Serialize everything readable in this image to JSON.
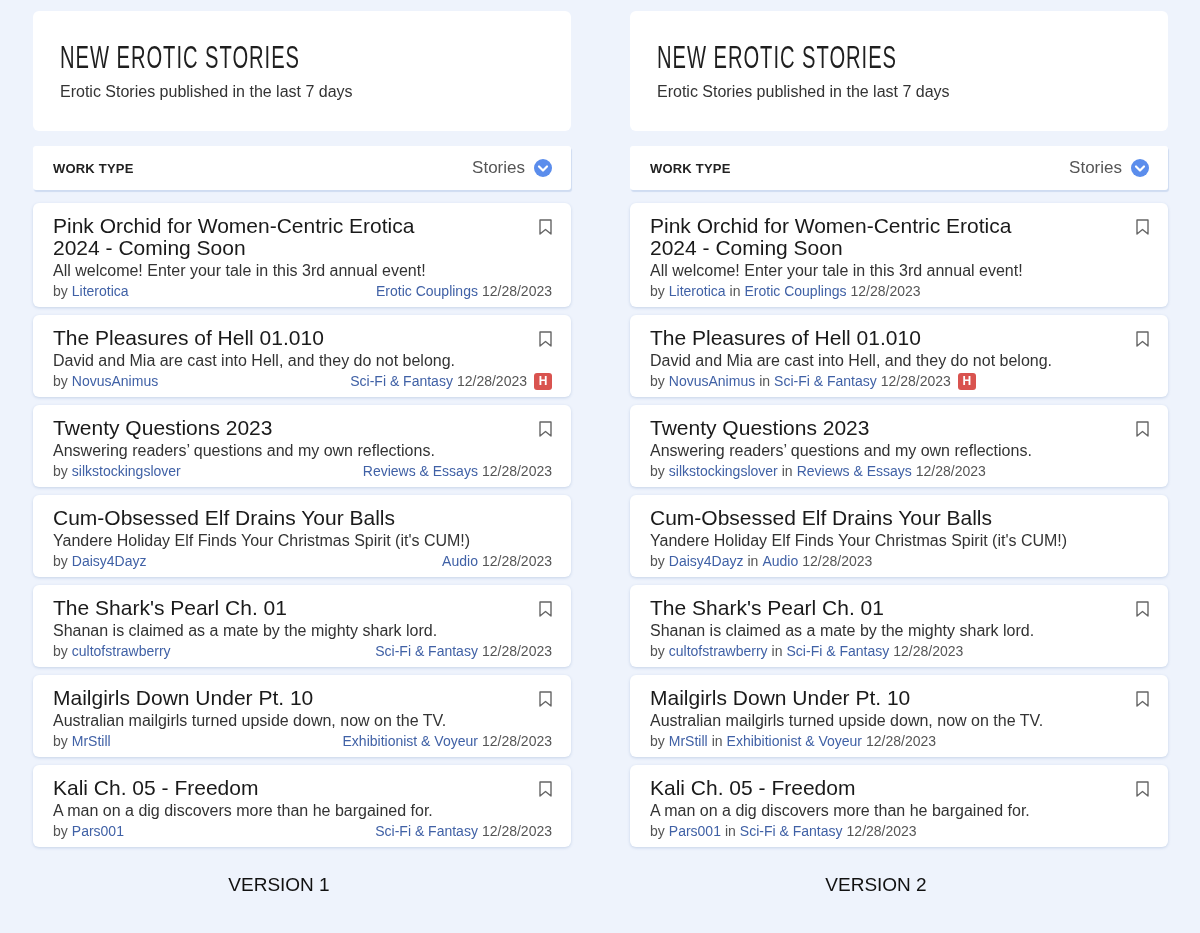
{
  "versions": [
    {
      "kind": "split",
      "header": {
        "title": "NEW EROTIC STORIES",
        "subtitle": "Erotic Stories published in the last 7 days"
      },
      "filter": {
        "label": "WORK TYPE",
        "value": "Stories"
      },
      "stories": [
        {
          "title": "Pink Orchid for Women-Centric Erotica 2024 - Coming Soon",
          "description": "All welcome! Enter your tale in this 3rd annual event!",
          "by": "by",
          "author": "Literotica",
          "category": "Erotic Couplings",
          "date": "12/28/2023",
          "bookmark": true
        },
        {
          "title": "The Pleasures of Hell 01.010",
          "description": "David and Mia are cast into Hell, and they do not belong.",
          "by": "by",
          "author": "NovusAnimus",
          "category": "Sci-Fi & Fantasy",
          "date": "12/28/2023",
          "badge": "H",
          "bookmark": true
        },
        {
          "title": "Twenty Questions 2023",
          "description": "Answering readers’ questions and my own reflections.",
          "by": "by",
          "author": "silkstockingslover",
          "category": "Reviews & Essays",
          "date": "12/28/2023",
          "bookmark": true
        },
        {
          "title": "Cum-Obsessed Elf Drains Your Balls",
          "description": "Yandere Holiday Elf Finds Your Christmas Spirit (it's CUM!)",
          "by": "by",
          "author": "Daisy4Dayz",
          "category": "Audio",
          "date": "12/28/2023",
          "bookmark": false
        },
        {
          "title": "The Shark's Pearl Ch. 01",
          "description": "Shanan is claimed as a mate by the mighty shark lord.",
          "by": "by",
          "author": "cultofstrawberry",
          "category": "Sci-Fi & Fantasy",
          "date": "12/28/2023",
          "bookmark": true
        },
        {
          "title": "Mailgirls Down Under Pt. 10",
          "description": "Australian mailgirls turned upside down, now on the TV.",
          "by": "by",
          "author": "MrStill",
          "category": "Exhibitionist & Voyeur",
          "date": "12/28/2023",
          "bookmark": true
        },
        {
          "title": "Kali Ch. 05 - Freedom",
          "description": "A man on a dig discovers more than he bargained for.",
          "by": "by",
          "author": "Pars001",
          "category": "Sci-Fi & Fantasy",
          "date": "12/28/2023",
          "bookmark": true
        }
      ],
      "caption": "VERSION 1"
    },
    {
      "kind": "inline",
      "header": {
        "title": "NEW EROTIC STORIES",
        "subtitle": "Erotic Stories published in the last 7 days"
      },
      "filter": {
        "label": "WORK TYPE",
        "value": "Stories"
      },
      "stories": [
        {
          "title": "Pink Orchid for Women-Centric Erotica 2024 - Coming Soon",
          "description": "All welcome! Enter your tale in this 3rd annual event!",
          "by": "by",
          "author": "Literotica",
          "in": "in",
          "category": "Erotic Couplings",
          "date": "12/28/2023",
          "bookmark": true
        },
        {
          "title": "The Pleasures of Hell 01.010",
          "description": "David and Mia are cast into Hell, and they do not belong.",
          "by": "by",
          "author": "NovusAnimus",
          "in": "in",
          "category": "Sci-Fi & Fantasy",
          "date": "12/28/2023",
          "badge": "H",
          "bookmark": true
        },
        {
          "title": "Twenty Questions 2023",
          "description": "Answering readers’ questions and my own reflections.",
          "by": "by",
          "author": "silkstockingslover",
          "in": "in",
          "category": "Reviews & Essays",
          "date": "12/28/2023",
          "bookmark": true
        },
        {
          "title": "Cum-Obsessed Elf Drains Your Balls",
          "description": "Yandere Holiday Elf Finds Your Christmas Spirit (it's CUM!)",
          "by": "by",
          "author": "Daisy4Dayz",
          "in": "in",
          "category": "Audio",
          "date": "12/28/2023",
          "bookmark": false
        },
        {
          "title": "The Shark's Pearl Ch. 01",
          "description": "Shanan is claimed as a mate by the mighty shark lord.",
          "by": "by",
          "author": "cultofstrawberry",
          "in": "in",
          "category": "Sci-Fi & Fantasy",
          "date": "12/28/2023",
          "bookmark": true
        },
        {
          "title": "Mailgirls Down Under Pt. 10",
          "description": "Australian mailgirls turned upside down, now on the TV.",
          "by": "by",
          "author": "MrStill",
          "in": "in",
          "category": "Exhibitionist & Voyeur",
          "date": "12/28/2023",
          "bookmark": true
        },
        {
          "title": "Kali Ch. 05 - Freedom",
          "description": "A man on a dig discovers more than he bargained for.",
          "by": "by",
          "author": "Pars001",
          "in": "in",
          "category": "Sci-Fi & Fantasy",
          "date": "12/28/2023",
          "bookmark": true
        }
      ],
      "caption": "VERSION 2"
    }
  ]
}
